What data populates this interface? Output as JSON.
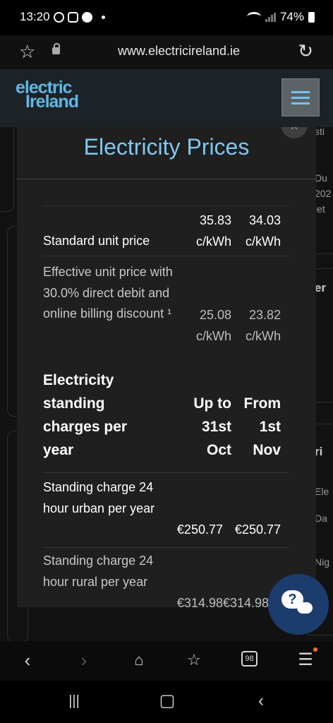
{
  "status_bar": {
    "time": "13:20",
    "battery": "74%"
  },
  "browser": {
    "url": "www.electricireland.ie"
  },
  "site": {
    "logo_line1": "electric",
    "logo_line2": "Ireland"
  },
  "modal": {
    "title": "Electricity Prices",
    "close_glyph": "^",
    "unit_rows": [
      {
        "label": "Standard unit price",
        "col1": "35.83 c/kWh",
        "col2": "34.03 c/kWh"
      },
      {
        "label": "Effective unit price with 30.0% direct debit and online billing discount ¹",
        "col1": "25.08 c/kWh",
        "col2": "23.82 c/kWh"
      }
    ],
    "standing_header": {
      "label": "Electricity standing charges per year",
      "col1": "Up to 31st Oct",
      "col2": "From 1st Nov"
    },
    "standing_rows": [
      {
        "label": "Standing charge 24 hour urban per year",
        "col1": "€250.77",
        "col2": "€250.77"
      },
      {
        "label": "Standing charge 24 hour rural per year",
        "col1": "€314.98",
        "col2": "€314.98"
      }
    ]
  },
  "background_fragments": [
    "sti",
    "Du",
    "202",
    "let",
    "er",
    "ri",
    "Ele",
    "Da",
    "Nig"
  ],
  "chat": {
    "label": "?"
  },
  "browser_nav": {
    "tabs_count": "98"
  }
}
